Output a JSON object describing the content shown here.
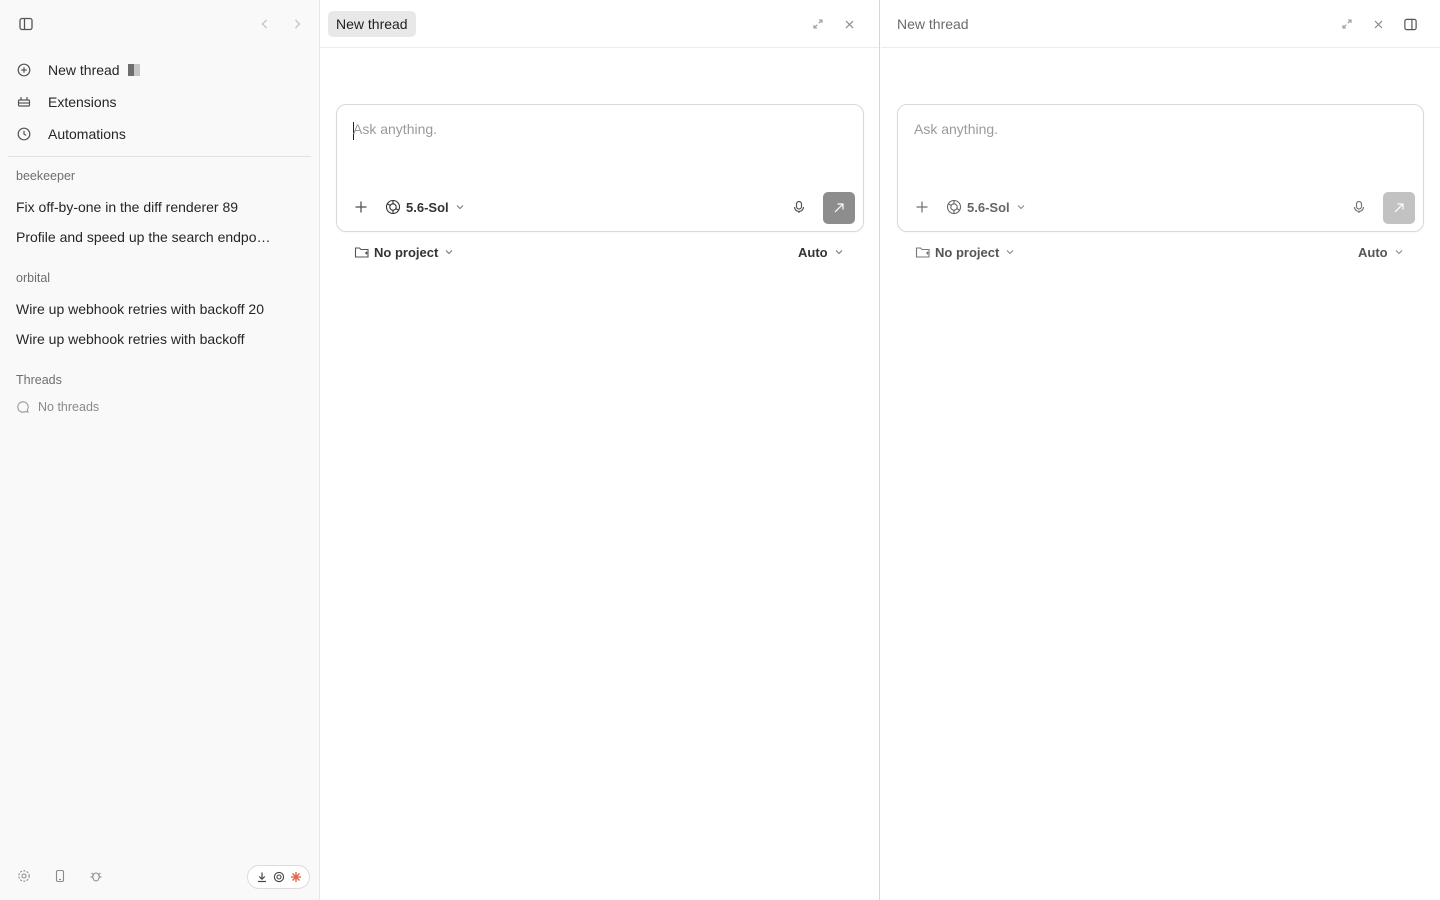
{
  "sidebar": {
    "nav": [
      {
        "label": "New thread",
        "icon": "new-thread-icon"
      },
      {
        "label": "Extensions",
        "icon": "extensions-icon"
      },
      {
        "label": "Automations",
        "icon": "clock-icon"
      }
    ],
    "groups": [
      {
        "name": "beekeeper",
        "threads": [
          "Fix off-by-one in the diff renderer 89",
          "Profile and speed up the search endpoint"
        ]
      },
      {
        "name": "orbital",
        "threads": [
          "Wire up webhook retries with backoff 20",
          "Wire up webhook retries with backoff"
        ]
      }
    ],
    "threads_section": {
      "label": "Threads",
      "empty_text": "No threads"
    }
  },
  "panes": [
    {
      "title": "New thread",
      "composer": {
        "placeholder": "Ask anything.",
        "model": "5.6-Sol"
      },
      "project": "No project",
      "mode": "Auto"
    },
    {
      "title": "New thread",
      "composer": {
        "placeholder": "Ask anything.",
        "model": "5.6-Sol"
      },
      "project": "No project",
      "mode": "Auto"
    }
  ],
  "colors": {
    "accent": "#e2674a",
    "sidebar_bg": "#f9f9f9",
    "send_active": "#8d8d8d",
    "send_inactive": "#c2c2c2"
  }
}
